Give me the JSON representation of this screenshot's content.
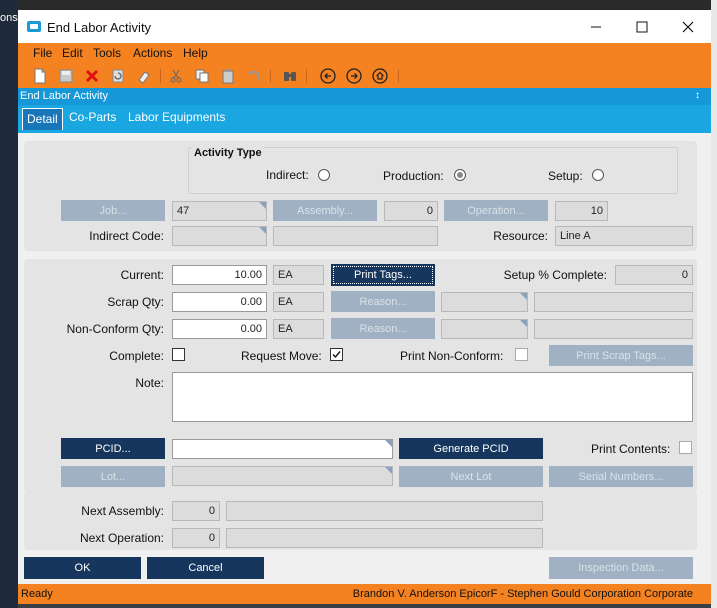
{
  "window": {
    "title": "End Labor Activity",
    "background_left_text": "ons"
  },
  "menu": [
    "File",
    "Edit",
    "Tools",
    "Actions",
    "Help"
  ],
  "toolbar_icons": [
    "new-icon",
    "save-icon",
    "delete-icon",
    "refresh-icon",
    "clear-icon",
    "cut-icon",
    "copy-icon",
    "paste-icon",
    "undo-icon",
    "search-icon",
    "back-icon",
    "forward-icon",
    "home-icon"
  ],
  "form_title": "End Labor Activity",
  "tabs": [
    "Detail",
    "Co-Parts",
    "Labor Equipments"
  ],
  "activity_type": {
    "title": "Activity Type",
    "indirect_label": "Indirect:",
    "production_label": "Production:",
    "setup_label": "Setup:",
    "selected": "Production"
  },
  "header": {
    "job_button": "Job...",
    "job_value": "47",
    "assembly_button": "Assembly...",
    "assembly_value": "0",
    "operation_button": "Operation...",
    "operation_value": "10",
    "indirect_code_label": "Indirect Code:",
    "resource_label": "Resource:",
    "resource_value": "Line A"
  },
  "quantities": {
    "current_label": "Current:",
    "current_value": "10.00",
    "current_uom": "EA",
    "print_tags_button": "Print Tags...",
    "setup_complete_label": "Setup % Complete:",
    "setup_complete_value": "0",
    "scrap_label": "Scrap Qty:",
    "scrap_value": "0.00",
    "scrap_uom": "EA",
    "reason_button": "Reason...",
    "nonconform_label": "Non-Conform Qty:",
    "nonconform_value": "0.00",
    "nonconform_uom": "EA",
    "complete_label": "Complete:",
    "complete_checked": false,
    "request_move_label": "Request Move:",
    "request_move_checked": true,
    "print_nonconform_label": "Print Non-Conform:",
    "print_nonconform_checked": false,
    "print_scrap_tags_button": "Print Scrap Tags...",
    "note_label": "Note:",
    "note_value": "",
    "pcid_button": "PCID...",
    "pcid_value": "",
    "generate_pcid_button": "Generate PCID",
    "print_contents_label": "Print Contents:",
    "lot_button": "Lot...",
    "next_lot_button": "Next Lot",
    "serial_numbers_button": "Serial Numbers..."
  },
  "next": {
    "assembly_label": "Next Assembly:",
    "assembly_value": "0",
    "operation_label": "Next Operation:",
    "operation_value": "0"
  },
  "footer": {
    "ok_button": "OK",
    "cancel_button": "Cancel",
    "inspection_button": "Inspection Data..."
  },
  "status": {
    "ready": "Ready",
    "info": "Brandon V. Anderson  EpicorF - Stephen Gould Corporation  Corporate"
  }
}
